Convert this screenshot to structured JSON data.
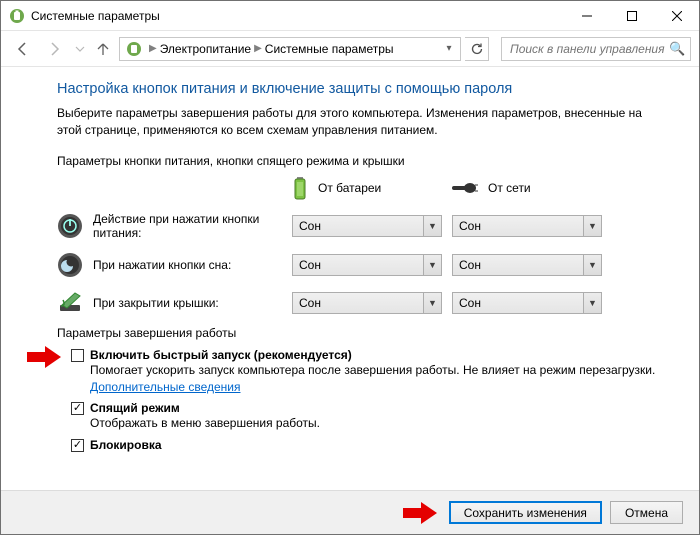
{
  "window": {
    "title": "Системные параметры"
  },
  "breadcrumb": {
    "item1": "Электропитание",
    "item2": "Системные параметры"
  },
  "search": {
    "placeholder": "Поиск в панели управления"
  },
  "main": {
    "heading": "Настройка кнопок питания и включение защиты с помощью пароля",
    "description": "Выберите параметры завершения работы для этого компьютера. Изменения параметров, внесенные на этой странице, применяются ко всем схемам управления питанием.",
    "buttons_section_title": "Параметры кнопки питания, кнопки спящего режима и крышки",
    "col_battery": "От батареи",
    "col_ac": "От сети",
    "rows": [
      {
        "label": "Действие при нажатии кнопки питания:",
        "battery": "Сон",
        "ac": "Сон"
      },
      {
        "label": "При нажатии кнопки сна:",
        "battery": "Сон",
        "ac": "Сон"
      },
      {
        "label": "При закрытии крышки:",
        "battery": "Сон",
        "ac": "Сон"
      }
    ],
    "shutdown_section_title": "Параметры завершения работы",
    "options": [
      {
        "checked": false,
        "label": "Включить быстрый запуск (рекомендуется)",
        "desc": "Помогает ускорить запуск компьютера после завершения работы. Не влияет на режим перезагрузки. ",
        "link": "Дополнительные сведения"
      },
      {
        "checked": true,
        "label": "Спящий режим",
        "desc": "Отображать в меню завершения работы."
      },
      {
        "checked": true,
        "label": "Блокировка"
      }
    ]
  },
  "footer": {
    "save": "Сохранить изменения",
    "cancel": "Отмена"
  }
}
